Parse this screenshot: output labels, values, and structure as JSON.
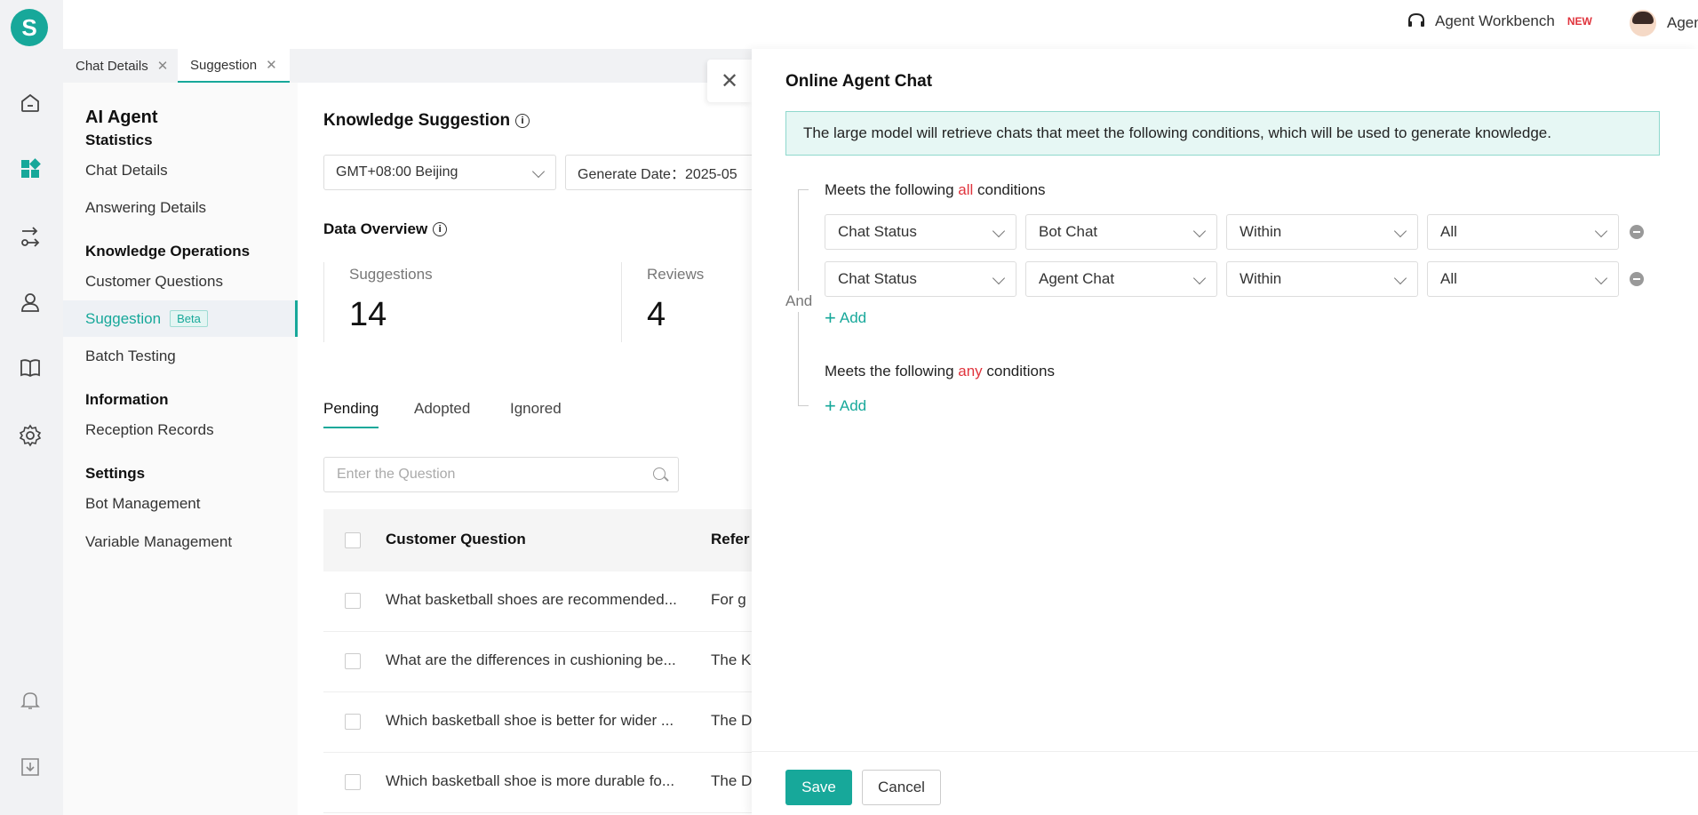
{
  "app": {
    "logo_letter": "S"
  },
  "rail": {
    "icons": [
      "home-icon",
      "dashboard-icon",
      "flow-icon",
      "agent-icon",
      "book-icon",
      "gear-icon",
      "bell-icon",
      "download-icon"
    ]
  },
  "header": {
    "workbench_label": "Agent Workbench",
    "new_badge": "NEW",
    "user_name": "Agent"
  },
  "tabs": [
    {
      "label": "Chat Details",
      "active": false
    },
    {
      "label": "Suggestion",
      "active": true
    }
  ],
  "sidenav": {
    "title": "AI Agent",
    "groups": [
      {
        "title": "Statistics",
        "items": [
          "Chat Details",
          "Answering Details"
        ]
      },
      {
        "title": "Knowledge Operations",
        "items": [
          "Customer Questions",
          "Suggestion",
          "Batch Testing"
        ]
      },
      {
        "title": "Information",
        "items": [
          "Reception Records"
        ]
      },
      {
        "title": "Settings",
        "items": [
          "Bot Management",
          "Variable Management"
        ]
      }
    ],
    "beta_badge": "Beta"
  },
  "main": {
    "title": "Knowledge Suggestion",
    "timezone": "GMT+08:00 Beijing",
    "generate_date": "Generate Date：2025-05",
    "overview_title": "Data Overview",
    "stats": [
      {
        "label": "Suggestions",
        "value": "14"
      },
      {
        "label": "Reviews",
        "value": "4"
      }
    ],
    "list_tabs": [
      "Pending",
      "Adopted",
      "Ignored"
    ],
    "search_placeholder": "Enter the Question",
    "columns": [
      "Customer Question",
      "Refer"
    ],
    "rows": [
      {
        "question": "What basketball shoes are recommended...",
        "ref": "For g"
      },
      {
        "question": "What are the differences in cushioning be...",
        "ref": "The K"
      },
      {
        "question": "Which basketball shoe is better for wider ...",
        "ref": "The D"
      },
      {
        "question": "Which basketball shoe is more durable fo...",
        "ref": "The D"
      }
    ]
  },
  "drawer": {
    "title": "Online Agent Chat",
    "notice": "The large model will retrieve chats that meet the following conditions, which will be used to generate knowledge.",
    "and_label": "And",
    "all_group": {
      "prefix": "Meets the following ",
      "keyword": "all",
      "suffix": " conditions",
      "rows": [
        [
          "Chat Status",
          "Bot Chat",
          "Within",
          "All"
        ],
        [
          "Chat Status",
          "Agent Chat",
          "Within",
          "All"
        ]
      ]
    },
    "any_group": {
      "prefix": "Meets the following ",
      "keyword": "any",
      "suffix": " conditions"
    },
    "add_label": "Add",
    "save_label": "Save",
    "cancel_label": "Cancel"
  }
}
